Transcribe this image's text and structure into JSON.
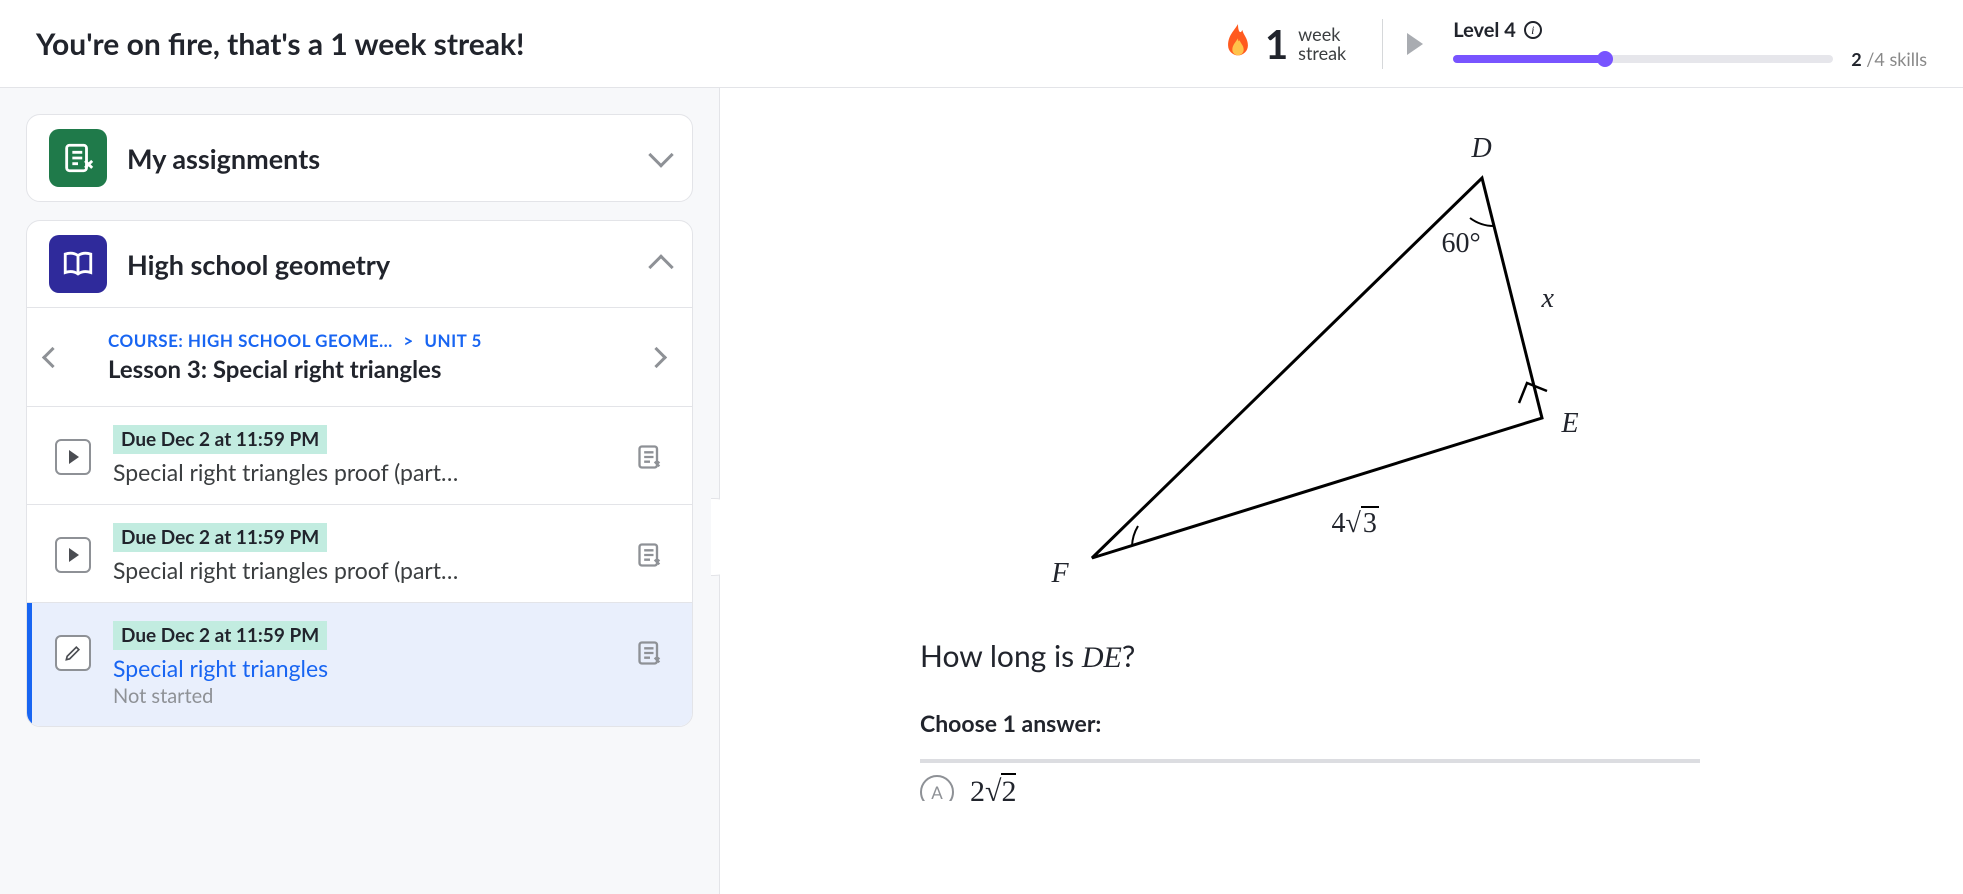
{
  "topbar": {
    "streak_message": "You're on fire, that's a 1 week streak!",
    "streak_number": "1",
    "streak_label_top": "week",
    "streak_label_bot": "streak",
    "level_label": "Level 4",
    "skills_current": "2",
    "skills_total": " /4 skills",
    "progress_percent": 40
  },
  "sidebar": {
    "my_assignments": "My assignments",
    "course_card_title": "High school geometry",
    "breadcrumb_course": "COURSE: HIGH SCHOOL GEOME…",
    "breadcrumb_sep": ">",
    "breadcrumb_unit": "UNIT 5",
    "lesson_title": "Lesson 3: Special right triangles",
    "items": [
      {
        "due": "Due Dec 2 at 11:59 PM",
        "title": "Special right triangles proof (part…",
        "type": "video"
      },
      {
        "due": "Due Dec 2 at 11:59 PM",
        "title": "Special right triangles proof (part…",
        "type": "video"
      },
      {
        "due": "Due Dec 2 at 11:59 PM",
        "title": "Special right triangles",
        "status": "Not started",
        "type": "exercise",
        "active": true
      }
    ]
  },
  "content": {
    "triangle": {
      "vertex_D": "D",
      "vertex_E": "E",
      "vertex_F": "F",
      "angle_D": "60°",
      "side_DE": "x",
      "side_FE_coef": "4",
      "side_FE_rad": "3"
    },
    "question_prefix": "How long is ",
    "question_var": "DE",
    "question_suffix": "?",
    "choose": "Choose 1 answer:",
    "opt_letter": "A"
  }
}
